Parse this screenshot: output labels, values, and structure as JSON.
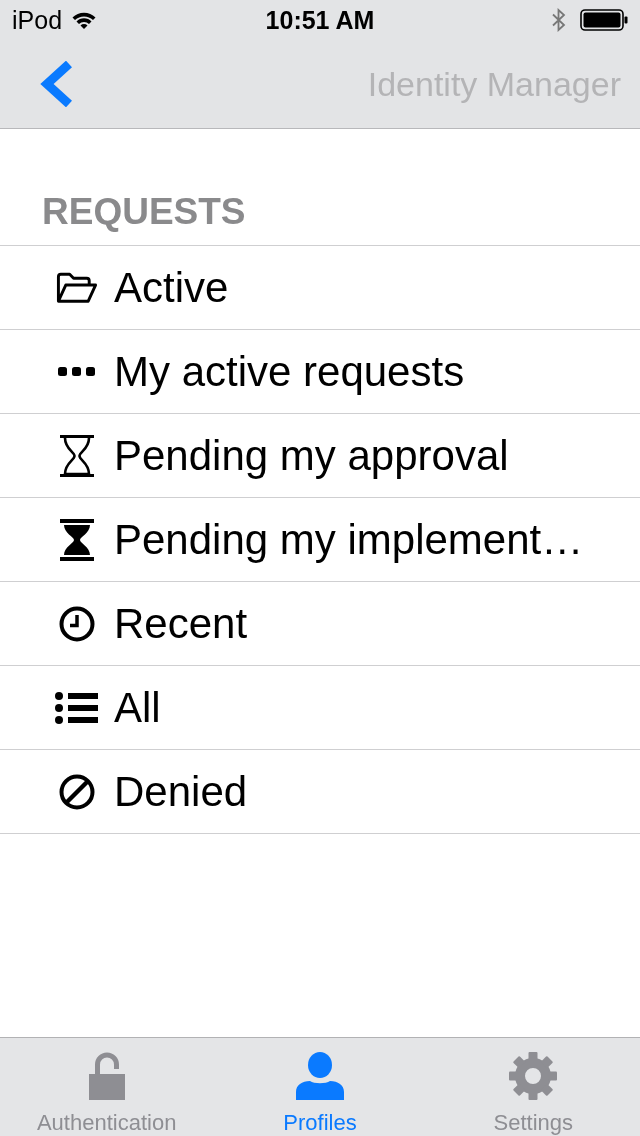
{
  "status_bar": {
    "carrier": "iPod",
    "time": "10:51 AM"
  },
  "nav_bar": {
    "title": "Identity Manager"
  },
  "section": {
    "title": "REQUESTS"
  },
  "items": [
    {
      "label": "Active",
      "kind": "folder"
    },
    {
      "label": "My active requests",
      "kind": "dots"
    },
    {
      "label": "Pending my approval",
      "kind": "hourglass"
    },
    {
      "label": "Pending my implement…",
      "kind": "sandglass"
    },
    {
      "label": "Recent",
      "kind": "clock"
    },
    {
      "label": "All",
      "kind": "list"
    },
    {
      "label": "Denied",
      "kind": "ban"
    }
  ],
  "tabs": [
    {
      "label": "Authentication",
      "kind": "lock",
      "selected": false
    },
    {
      "label": "Profiles",
      "kind": "person",
      "selected": true
    },
    {
      "label": "Settings",
      "kind": "gear",
      "selected": false
    }
  ]
}
